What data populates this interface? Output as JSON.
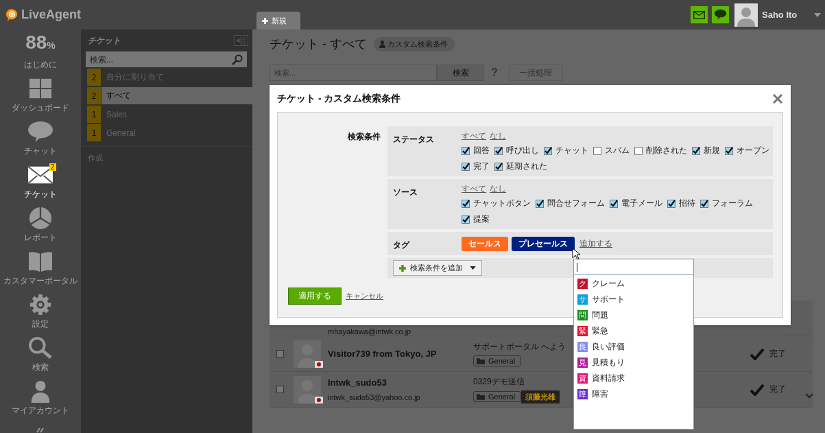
{
  "app": {
    "logo": "LiveAgent"
  },
  "nav": [
    {
      "kind": "stat",
      "value": "88",
      "unit": "%",
      "label": "はじめに",
      "selected": false
    },
    {
      "kind": "dashboard",
      "label": "ダッシュボード",
      "selected": false
    },
    {
      "kind": "chat",
      "label": "チャット",
      "selected": false
    },
    {
      "kind": "tickets",
      "label": "チケット",
      "badge": "2",
      "selected": true
    },
    {
      "kind": "reports",
      "label": "レポート",
      "selected": false
    },
    {
      "kind": "portal",
      "label": "カスタマーポータル",
      "selected": false
    },
    {
      "kind": "settings",
      "label": "設定",
      "selected": false
    },
    {
      "kind": "search",
      "label": "検索",
      "selected": false
    },
    {
      "kind": "account",
      "label": "マイアカウント",
      "selected": false
    }
  ],
  "ticket_panel": {
    "title": "チケット",
    "search": {
      "placeholder": "検索..."
    },
    "filters": [
      {
        "count": "2",
        "label": "自分に割り当て",
        "selected": false
      },
      {
        "count": "2",
        "label": "すべて",
        "selected": true
      },
      {
        "count": "1",
        "label": "Sales",
        "selected": false
      },
      {
        "count": "1",
        "label": "General",
        "selected": false
      }
    ],
    "create": "作成"
  },
  "top_bar": {
    "tabs": [
      {
        "label": "新規"
      }
    ],
    "user": {
      "name": "Saho Ito"
    }
  },
  "main": {
    "title": "チケット - すべて",
    "filter_chip": "カスタム検索条件",
    "search": {
      "placeholder": "検索..."
    },
    "search_button": "検索",
    "help": "?",
    "bulk_button": "一括処理",
    "rows": [
      {
        "email": "mhayakawa@intwk.co.jp"
      },
      {
        "name": "Visitor739 from Tokyo, JP",
        "subject": "サポートポータル へよう",
        "department": "General",
        "status": "完了",
        "checked": false
      },
      {
        "name": "Intwk_sudo53",
        "email": "intwk_sudo53@yahoo.co.jp",
        "subject": "0329デモ送信",
        "department": "General",
        "agent": "須藤光雄",
        "status": "完了",
        "checked": false
      }
    ]
  },
  "dialog": {
    "title": "チケット - カスタム検索条件",
    "criteria_label": "検索条件",
    "sections": [
      {
        "kind": "checks",
        "label": "ステータス",
        "all": "すべて",
        "none": "なし",
        "options": [
          {
            "label": "回答",
            "checked": true
          },
          {
            "label": "呼び出し",
            "checked": true
          },
          {
            "label": "チャット",
            "checked": true
          },
          {
            "label": "スパム",
            "checked": false
          },
          {
            "label": "削除された",
            "checked": false
          },
          {
            "label": "新規",
            "checked": true
          },
          {
            "label": "オープン",
            "checked": true
          },
          {
            "label": "完了",
            "checked": true
          },
          {
            "label": "延期された",
            "checked": true
          }
        ]
      },
      {
        "kind": "checks",
        "label": "ソース",
        "all": "すべて",
        "none": "なし",
        "options": [
          {
            "label": "チャットボタン",
            "checked": true
          },
          {
            "label": "問合せフォーム",
            "checked": true
          },
          {
            "label": "電子メール",
            "checked": true
          },
          {
            "label": "招待",
            "checked": true
          },
          {
            "label": "フォーラム",
            "checked": true
          },
          {
            "label": "提案",
            "checked": true
          }
        ]
      },
      {
        "kind": "tags",
        "label": "タグ",
        "tags": [
          {
            "label": "セールス",
            "color": "#ff6a1f"
          },
          {
            "label": "プレセールス",
            "color": "#00207f"
          }
        ],
        "add": "追加する"
      }
    ],
    "add_criteria": "検索条件を追加",
    "apply": "適用する",
    "cancel": "キャンセル"
  },
  "tag_dropdown": {
    "items": [
      {
        "letter": "ク",
        "label": "クレーム",
        "color": "#c8102e"
      },
      {
        "letter": "サ",
        "label": "サポート",
        "color": "#0ea0d8"
      },
      {
        "letter": "問",
        "label": "問題",
        "color": "#1a8c1a"
      },
      {
        "letter": "緊",
        "label": "緊急",
        "color": "#e8102e"
      },
      {
        "letter": "良",
        "label": "良い評価",
        "color": "#8890ee"
      },
      {
        "letter": "見",
        "label": "見積もり",
        "color": "#b0209a"
      },
      {
        "letter": "資",
        "label": "資料請求",
        "color": "#e8107a"
      },
      {
        "letter": "障",
        "label": "障害",
        "color": "#6a2ad0"
      }
    ]
  }
}
